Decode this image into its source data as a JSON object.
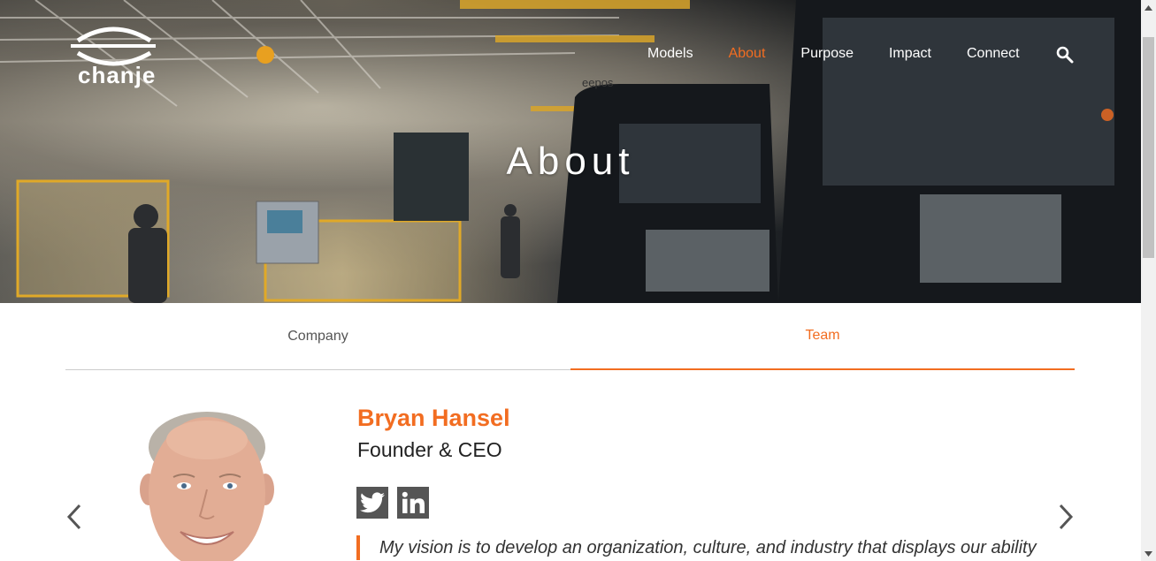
{
  "brand": {
    "name": "chanje"
  },
  "nav": {
    "items": [
      {
        "label": "Models",
        "active": false
      },
      {
        "label": "About",
        "active": true
      },
      {
        "label": "Purpose",
        "active": false
      },
      {
        "label": "Impact",
        "active": false
      },
      {
        "label": "Connect",
        "active": false
      }
    ],
    "search_icon": "search-icon"
  },
  "hero": {
    "title": "About",
    "sign_text": "eepos"
  },
  "tabs": [
    {
      "label": "Company",
      "active": false
    },
    {
      "label": "Team",
      "active": true
    }
  ],
  "member": {
    "name": "Bryan Hansel",
    "role": "Founder & CEO",
    "social": [
      "twitter-icon",
      "linkedin-icon"
    ],
    "quote": "My vision is to develop an organization, culture, and industry that displays our ability"
  },
  "colors": {
    "accent": "#f26d21",
    "social_bg": "#555555",
    "text": "#222222"
  }
}
